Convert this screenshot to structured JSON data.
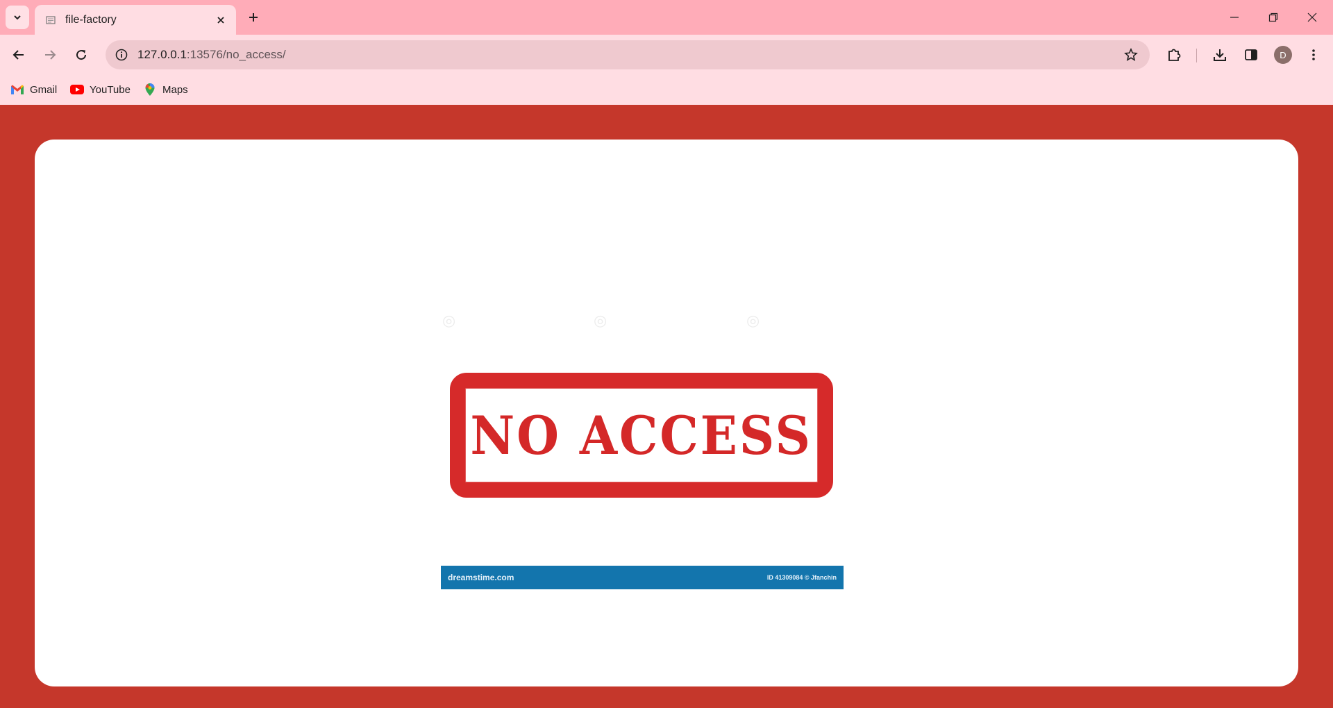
{
  "browser": {
    "tab": {
      "title": "file-factory"
    },
    "address": {
      "host": "127.0.0.1",
      "rest": ":13576/no_access/"
    },
    "profile_initial": "D",
    "bookmarks": [
      {
        "label": "Gmail",
        "icon": "gmail-icon"
      },
      {
        "label": "YouTube",
        "icon": "youtube-icon"
      },
      {
        "label": "Maps",
        "icon": "maps-icon"
      }
    ]
  },
  "page": {
    "image": {
      "stamp_text": "NO ACCESS",
      "watermark_left": "dreamstime.com",
      "watermark_right": "ID 41309084 © Jfanchin"
    }
  },
  "colors": {
    "page_background": "#c5372b",
    "card": "#ffffff",
    "stamp_red": "#d62a2a",
    "watermark_band": "#1375ad",
    "tabstrip": "#ffacb8",
    "toolbar": "#ffdde3"
  }
}
